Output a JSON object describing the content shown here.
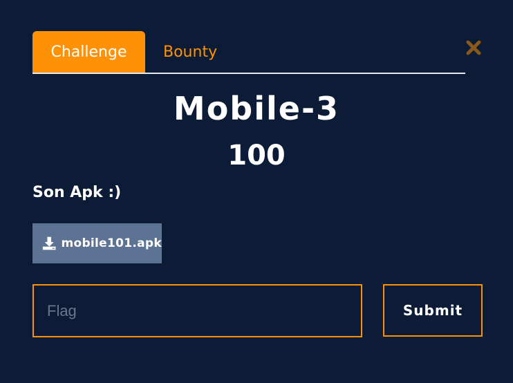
{
  "tabs": {
    "challenge_label": "Challenge",
    "bounty_label": "Bounty",
    "active": "Challenge"
  },
  "challenge": {
    "name": "Mobile-3",
    "points": "100",
    "description": "Son Apk :)",
    "file": {
      "name": "mobile101.apk",
      "icon": "download-icon"
    }
  },
  "form": {
    "flag_placeholder": "Flag",
    "flag_value": "",
    "submit_label": "Submit"
  },
  "icons": {
    "close": "close-icon"
  },
  "colors": {
    "background": "#0c1b36",
    "accent": "#ff9106",
    "file_button": "#5c7394",
    "close_icon": "#8a5a1c",
    "text": "#ffffff"
  }
}
